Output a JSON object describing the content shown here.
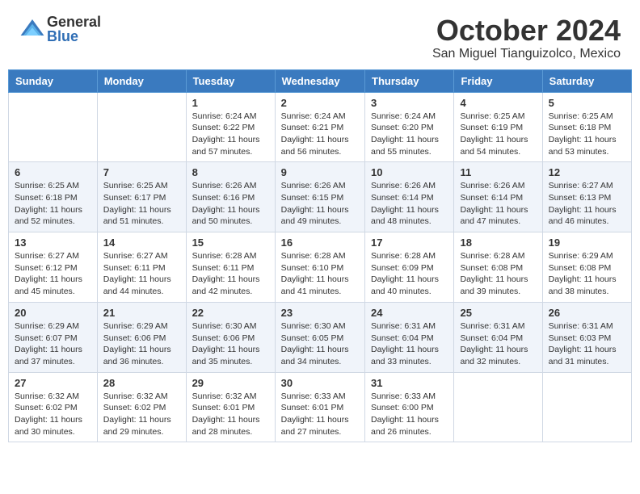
{
  "header": {
    "logo_general": "General",
    "logo_blue": "Blue",
    "month_title": "October 2024",
    "location": "San Miguel Tianguizolco, Mexico"
  },
  "days_of_week": [
    "Sunday",
    "Monday",
    "Tuesday",
    "Wednesday",
    "Thursday",
    "Friday",
    "Saturday"
  ],
  "weeks": [
    [
      {
        "day": "",
        "sunrise": "",
        "sunset": "",
        "daylight": ""
      },
      {
        "day": "",
        "sunrise": "",
        "sunset": "",
        "daylight": ""
      },
      {
        "day": "1",
        "sunrise": "Sunrise: 6:24 AM",
        "sunset": "Sunset: 6:22 PM",
        "daylight": "Daylight: 11 hours and 57 minutes."
      },
      {
        "day": "2",
        "sunrise": "Sunrise: 6:24 AM",
        "sunset": "Sunset: 6:21 PM",
        "daylight": "Daylight: 11 hours and 56 minutes."
      },
      {
        "day": "3",
        "sunrise": "Sunrise: 6:24 AM",
        "sunset": "Sunset: 6:20 PM",
        "daylight": "Daylight: 11 hours and 55 minutes."
      },
      {
        "day": "4",
        "sunrise": "Sunrise: 6:25 AM",
        "sunset": "Sunset: 6:19 PM",
        "daylight": "Daylight: 11 hours and 54 minutes."
      },
      {
        "day": "5",
        "sunrise": "Sunrise: 6:25 AM",
        "sunset": "Sunset: 6:18 PM",
        "daylight": "Daylight: 11 hours and 53 minutes."
      }
    ],
    [
      {
        "day": "6",
        "sunrise": "Sunrise: 6:25 AM",
        "sunset": "Sunset: 6:18 PM",
        "daylight": "Daylight: 11 hours and 52 minutes."
      },
      {
        "day": "7",
        "sunrise": "Sunrise: 6:25 AM",
        "sunset": "Sunset: 6:17 PM",
        "daylight": "Daylight: 11 hours and 51 minutes."
      },
      {
        "day": "8",
        "sunrise": "Sunrise: 6:26 AM",
        "sunset": "Sunset: 6:16 PM",
        "daylight": "Daylight: 11 hours and 50 minutes."
      },
      {
        "day": "9",
        "sunrise": "Sunrise: 6:26 AM",
        "sunset": "Sunset: 6:15 PM",
        "daylight": "Daylight: 11 hours and 49 minutes."
      },
      {
        "day": "10",
        "sunrise": "Sunrise: 6:26 AM",
        "sunset": "Sunset: 6:14 PM",
        "daylight": "Daylight: 11 hours and 48 minutes."
      },
      {
        "day": "11",
        "sunrise": "Sunrise: 6:26 AM",
        "sunset": "Sunset: 6:14 PM",
        "daylight": "Daylight: 11 hours and 47 minutes."
      },
      {
        "day": "12",
        "sunrise": "Sunrise: 6:27 AM",
        "sunset": "Sunset: 6:13 PM",
        "daylight": "Daylight: 11 hours and 46 minutes."
      }
    ],
    [
      {
        "day": "13",
        "sunrise": "Sunrise: 6:27 AM",
        "sunset": "Sunset: 6:12 PM",
        "daylight": "Daylight: 11 hours and 45 minutes."
      },
      {
        "day": "14",
        "sunrise": "Sunrise: 6:27 AM",
        "sunset": "Sunset: 6:11 PM",
        "daylight": "Daylight: 11 hours and 44 minutes."
      },
      {
        "day": "15",
        "sunrise": "Sunrise: 6:28 AM",
        "sunset": "Sunset: 6:11 PM",
        "daylight": "Daylight: 11 hours and 42 minutes."
      },
      {
        "day": "16",
        "sunrise": "Sunrise: 6:28 AM",
        "sunset": "Sunset: 6:10 PM",
        "daylight": "Daylight: 11 hours and 41 minutes."
      },
      {
        "day": "17",
        "sunrise": "Sunrise: 6:28 AM",
        "sunset": "Sunset: 6:09 PM",
        "daylight": "Daylight: 11 hours and 40 minutes."
      },
      {
        "day": "18",
        "sunrise": "Sunrise: 6:28 AM",
        "sunset": "Sunset: 6:08 PM",
        "daylight": "Daylight: 11 hours and 39 minutes."
      },
      {
        "day": "19",
        "sunrise": "Sunrise: 6:29 AM",
        "sunset": "Sunset: 6:08 PM",
        "daylight": "Daylight: 11 hours and 38 minutes."
      }
    ],
    [
      {
        "day": "20",
        "sunrise": "Sunrise: 6:29 AM",
        "sunset": "Sunset: 6:07 PM",
        "daylight": "Daylight: 11 hours and 37 minutes."
      },
      {
        "day": "21",
        "sunrise": "Sunrise: 6:29 AM",
        "sunset": "Sunset: 6:06 PM",
        "daylight": "Daylight: 11 hours and 36 minutes."
      },
      {
        "day": "22",
        "sunrise": "Sunrise: 6:30 AM",
        "sunset": "Sunset: 6:06 PM",
        "daylight": "Daylight: 11 hours and 35 minutes."
      },
      {
        "day": "23",
        "sunrise": "Sunrise: 6:30 AM",
        "sunset": "Sunset: 6:05 PM",
        "daylight": "Daylight: 11 hours and 34 minutes."
      },
      {
        "day": "24",
        "sunrise": "Sunrise: 6:31 AM",
        "sunset": "Sunset: 6:04 PM",
        "daylight": "Daylight: 11 hours and 33 minutes."
      },
      {
        "day": "25",
        "sunrise": "Sunrise: 6:31 AM",
        "sunset": "Sunset: 6:04 PM",
        "daylight": "Daylight: 11 hours and 32 minutes."
      },
      {
        "day": "26",
        "sunrise": "Sunrise: 6:31 AM",
        "sunset": "Sunset: 6:03 PM",
        "daylight": "Daylight: 11 hours and 31 minutes."
      }
    ],
    [
      {
        "day": "27",
        "sunrise": "Sunrise: 6:32 AM",
        "sunset": "Sunset: 6:02 PM",
        "daylight": "Daylight: 11 hours and 30 minutes."
      },
      {
        "day": "28",
        "sunrise": "Sunrise: 6:32 AM",
        "sunset": "Sunset: 6:02 PM",
        "daylight": "Daylight: 11 hours and 29 minutes."
      },
      {
        "day": "29",
        "sunrise": "Sunrise: 6:32 AM",
        "sunset": "Sunset: 6:01 PM",
        "daylight": "Daylight: 11 hours and 28 minutes."
      },
      {
        "day": "30",
        "sunrise": "Sunrise: 6:33 AM",
        "sunset": "Sunset: 6:01 PM",
        "daylight": "Daylight: 11 hours and 27 minutes."
      },
      {
        "day": "31",
        "sunrise": "Sunrise: 6:33 AM",
        "sunset": "Sunset: 6:00 PM",
        "daylight": "Daylight: 11 hours and 26 minutes."
      },
      {
        "day": "",
        "sunrise": "",
        "sunset": "",
        "daylight": ""
      },
      {
        "day": "",
        "sunrise": "",
        "sunset": "",
        "daylight": ""
      }
    ]
  ]
}
